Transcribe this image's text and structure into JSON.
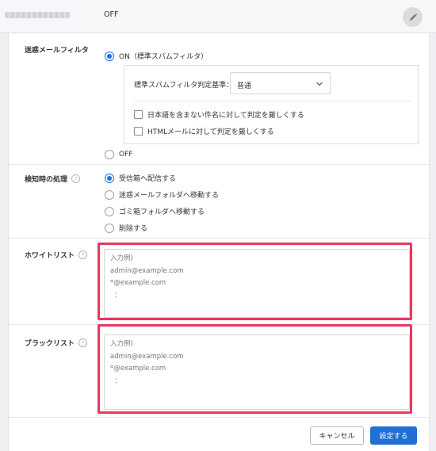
{
  "top_bar": {
    "setting_value": "OFF"
  },
  "spam_filter": {
    "label": "迷惑メールフィルタ",
    "option_on": "ON（標準スパムフィルタ）",
    "option_off": "OFF",
    "selected": "on",
    "criteria_label": "標準スパムフィルタ判定基準：",
    "criteria_value": "普通",
    "check_japanese": "日本語を含まない件名に対して判定を厳しくする",
    "check_html": "HTMLメールに対して判定を厳しくする"
  },
  "detection": {
    "label": "検知時の処理",
    "options": [
      "受信箱へ配信する",
      "迷惑メールフォルダへ移動する",
      "ゴミ箱フォルダへ移動する",
      "削除する"
    ],
    "selected_index": 0
  },
  "whitelist": {
    "label": "ホワイトリスト",
    "placeholder": "入力例)\nadmin@example.com\n*@example.com\n  ："
  },
  "blacklist": {
    "label": "ブラックリスト",
    "placeholder": "入力例)\nadmin@example.com\n*@example.com\n  ："
  },
  "buttons": {
    "cancel": "キャンセル",
    "save": "設定する"
  },
  "colors": {
    "accent": "#1f6fd6",
    "highlight": "#e8395c",
    "radio_selected": "#1e6fd9"
  },
  "icons": {
    "edit": "pencil-icon",
    "help": "question-circle-icon",
    "dropdown": "chevron-down-icon"
  }
}
